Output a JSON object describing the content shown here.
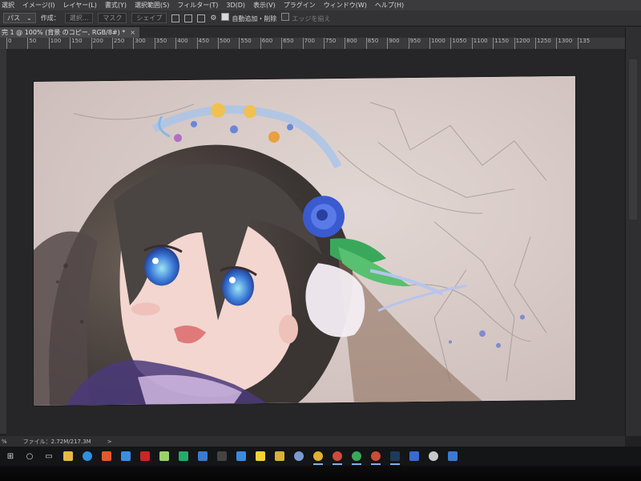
{
  "menubar": {
    "items": [
      "選択",
      "イメージ(I)",
      "レイヤー(L)",
      "書式(Y)",
      "選択範囲(S)",
      "フィルター(T)",
      "3D(D)",
      "表示(V)",
      "プラグイン",
      "ウィンドウ(W)",
      "ヘルプ(H)"
    ]
  },
  "options": {
    "mode_select": "パス",
    "create_label": "作成：",
    "selection_button": "選択...",
    "mask_button": "マスク",
    "shape_button": "シェイプ",
    "auto_add_delete": "自動追加・削除",
    "align_edges": "エッジを揃え"
  },
  "document": {
    "tab_title": "完 1 @ 100% (背景 のコピー, RGB/8#) *",
    "close_symbol": "×"
  },
  "ruler": {
    "ticks": [
      "0",
      "50",
      "100",
      "150",
      "200",
      "250",
      "300",
      "350",
      "400",
      "450",
      "500",
      "550",
      "600",
      "650",
      "700",
      "750",
      "800",
      "850",
      "900",
      "950",
      "1000",
      "1050",
      "1100",
      "1150",
      "1200",
      "1250",
      "1300",
      "135"
    ]
  },
  "status": {
    "zoom": "%",
    "file_info": "ファイル：2.72M/217.3M",
    "arrow": ">"
  },
  "taskbar": {
    "apps": [
      {
        "icon": "start-icon",
        "color": "#d9d9d9"
      },
      {
        "icon": "search-icon",
        "color": "#d9d9d9"
      },
      {
        "icon": "task-view-icon",
        "color": "#d9d9d9"
      },
      {
        "icon": "file-explorer-icon",
        "color": "#e6b84a"
      },
      {
        "icon": "edge-icon",
        "color": "#2f8fe0"
      },
      {
        "icon": "photos-icon",
        "color": "#e05a2a"
      },
      {
        "icon": "vscode-icon",
        "color": "#3a8ee0"
      },
      {
        "icon": "filezilla-icon",
        "color": "#c8262a"
      },
      {
        "icon": "notepad-icon",
        "color": "#9bd06a"
      },
      {
        "icon": "app-icon-1",
        "color": "#2aa86a"
      },
      {
        "icon": "mail-icon",
        "color": "#3a7ad0"
      },
      {
        "icon": "terminal-icon",
        "color": "#444444"
      },
      {
        "icon": "network-icon",
        "color": "#3a8ae0"
      },
      {
        "icon": "sticky-notes-icon",
        "color": "#f2d33a"
      },
      {
        "icon": "app-icon-2",
        "color": "#d8b040"
      },
      {
        "icon": "globe-icon",
        "color": "#7a9ad0"
      },
      {
        "icon": "chrome-icon",
        "color": "#e0b030"
      },
      {
        "icon": "chrome-icon-2",
        "color": "#d04a3a"
      },
      {
        "icon": "chrome-icon-3",
        "color": "#3aa85a"
      },
      {
        "icon": "chrome-icon-4",
        "color": "#d04a3a"
      },
      {
        "icon": "photoshop-icon",
        "color": "#1e3a5a"
      },
      {
        "icon": "app-icon-3",
        "color": "#3a6ad0"
      },
      {
        "icon": "itunes-icon",
        "color": "#c8c8c8"
      },
      {
        "icon": "app-icon-4",
        "color": "#3a7ad0"
      }
    ]
  },
  "colors": {
    "paper": "#d8cbc8",
    "hair": "#4a4442",
    "accent_blue": "#5a72d8"
  }
}
